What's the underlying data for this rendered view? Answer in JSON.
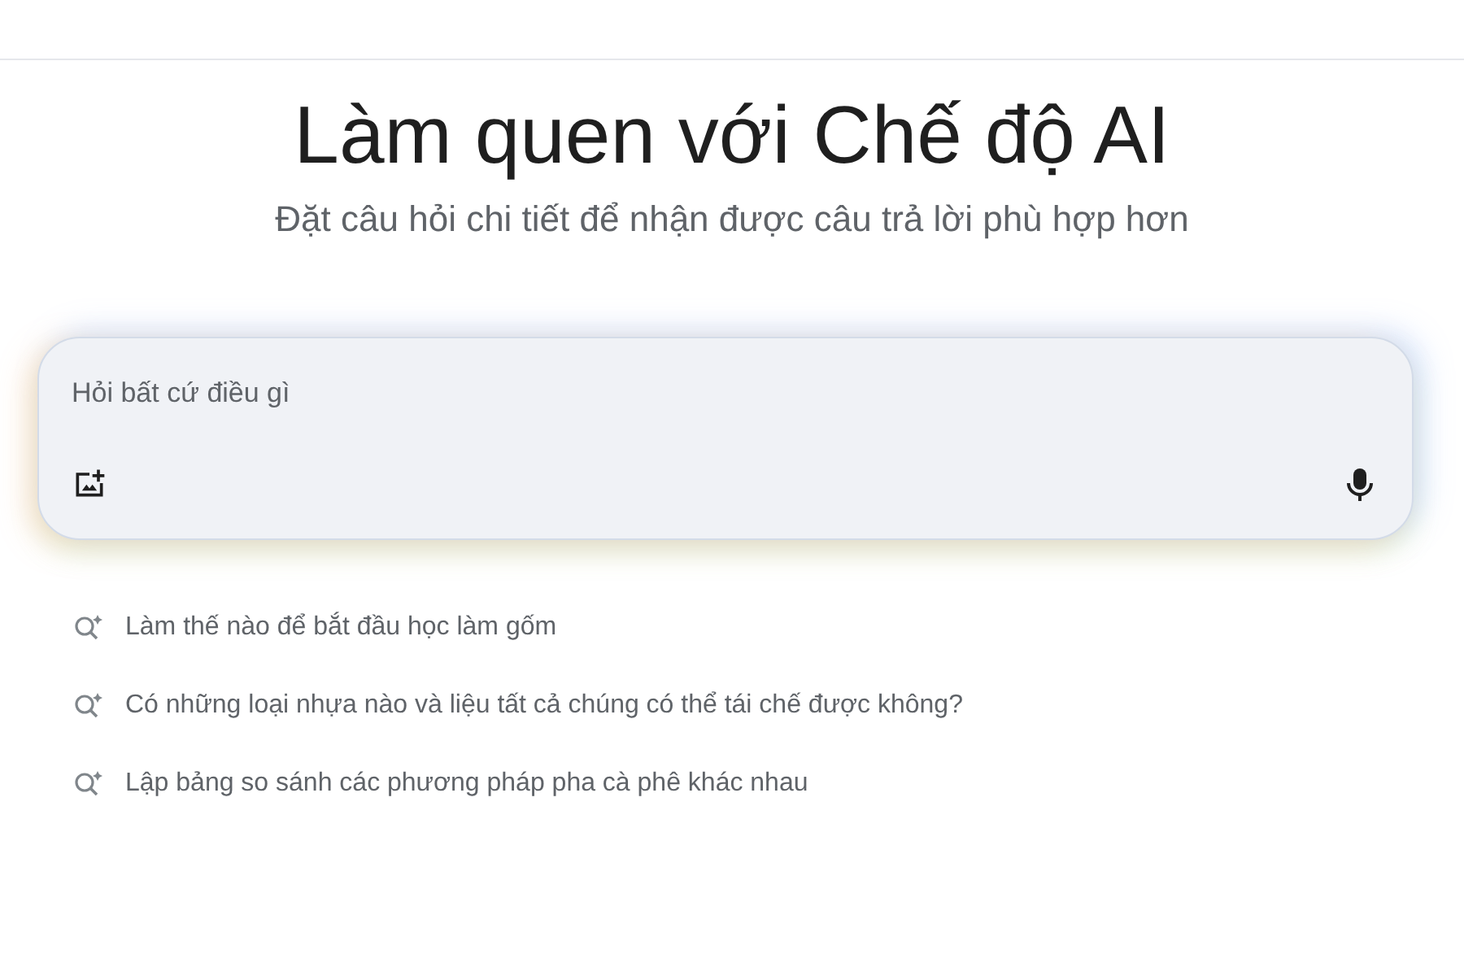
{
  "heading": {
    "title": "Làm quen với Chế độ AI",
    "subtitle": "Đặt câu hỏi chi tiết để nhận được câu trả lời phù hợp hơn"
  },
  "prompt_box": {
    "placeholder": "Hỏi bất cứ điều gì"
  },
  "suggestions": [
    {
      "label": "Làm thế nào để bắt đầu học làm gốm"
    },
    {
      "label": "Có những loại nhựa nào và liệu tất cả chúng có thể tái chế được không?"
    },
    {
      "label": "Lập bảng so sánh các phương pháp pha cà phê khác nhau"
    }
  ]
}
